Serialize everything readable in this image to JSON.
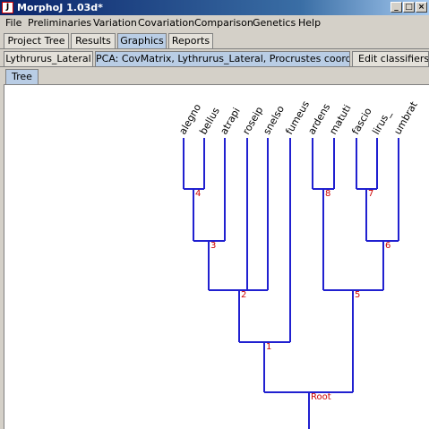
{
  "window": {
    "title": "MorphoJ 1.03d*",
    "minimize": "_",
    "maximize": "□",
    "close": "×"
  },
  "menu": [
    "File",
    "Preliminaries",
    "Variation",
    "Covariation",
    "Comparison",
    "Genetics",
    "Help"
  ],
  "main_tabs": [
    "Project Tree",
    "Results",
    "Graphics",
    "Reports"
  ],
  "graphics_tabs": [
    "Lythrurus_Lateral",
    "PCA: CovMatrix, Lythrurus_Lateral, Procrustes coordinates",
    "Edit classifiers in"
  ],
  "sub_tabs": [
    "Tree"
  ],
  "tree": {
    "taxa": [
      "alegno",
      "bellus",
      "atrapi",
      "roseip",
      "snelso",
      "fumeus",
      "ardens",
      "matuti",
      "fascio",
      "lirus_",
      "umbrat"
    ],
    "nodes": [
      "4",
      "3",
      "2",
      "1",
      "8",
      "7",
      "6",
      "5",
      "Root"
    ],
    "colors": {
      "branch": "#2020d0",
      "node_label": "#cc0000"
    }
  }
}
